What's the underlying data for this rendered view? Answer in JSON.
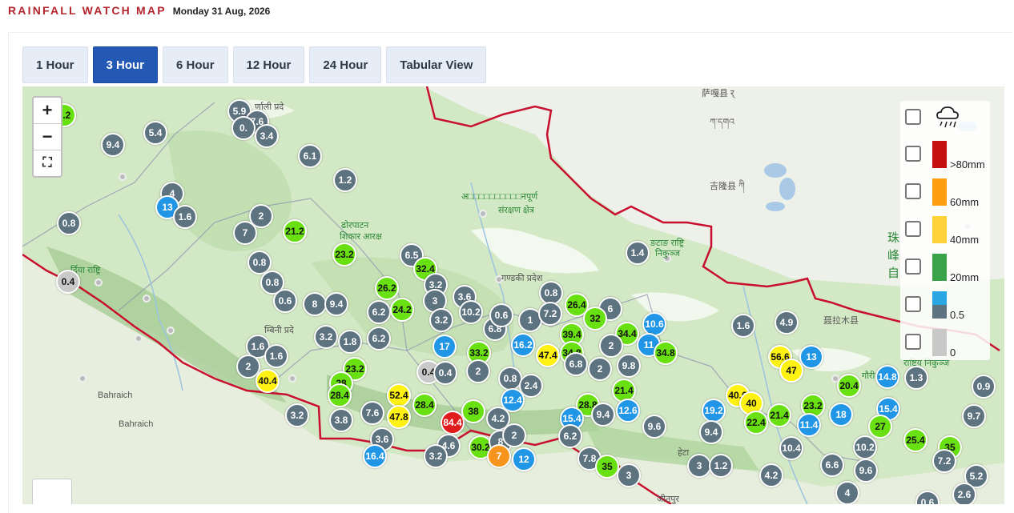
{
  "header": {
    "title": "RAINFALL WATCH MAP",
    "date": "Monday 31 Aug, 2026"
  },
  "tabs": [
    {
      "label": "1 Hour",
      "active": false
    },
    {
      "label": "3 Hour",
      "active": true
    },
    {
      "label": "6 Hour",
      "active": false
    },
    {
      "label": "12 Hour",
      "active": false
    },
    {
      "label": "24 Hour",
      "active": false
    },
    {
      "label": "Tabular View",
      "active": false
    }
  ],
  "legend": {
    "icon": "rain-cloud-icon",
    "items": [
      {
        "label": ">80mm",
        "color": "#c4100f"
      },
      {
        "label": "60mm",
        "color": "#ff9e10"
      },
      {
        "label": "40mm",
        "color": "#ffd23a"
      },
      {
        "label": "20mm",
        "color": "#3aa34a"
      },
      {
        "label": "0.5",
        "color": "#2aa7e3"
      },
      {
        "label": "0",
        "color": "#c8c8c8"
      }
    ]
  },
  "colors": {
    "gray": "#5e7380",
    "blue": "#2196e6",
    "green": "#69e012",
    "yellow": "#fff111",
    "orange": "#f7941d",
    "red": "#e01b1b",
    "zero": "#c9c9c9",
    "border": "#c8102e"
  },
  "map_labels": {
    "karnali": "र्णाली प्रदे",
    "bardiya": "र्दिया राष्ट्रि",
    "dhorpatan": "ढोरपाटन",
    "dhorpatan2": "शिकार आरक्ष",
    "annapurna": "अ□□□□□□□□□□नपूर्ण",
    "annapurna2": "संरक्षण क्षेत्र",
    "gandaki": "गण्डकी प्रदेश",
    "lumbini": "म्बिनी प्रदे",
    "bahraich1": "Bahraich",
    "bahraich2": "Bahraich",
    "tibet1": "萨嘎县 र्",
    "tibet2": "ཀ་དགའ",
    "jilong": "吉隆县 ཀི",
    "langtang": "ङटाङ राष्ट्रि",
    "langtang2": "निकुञ्ज",
    "nyalam": "聂拉木县",
    "gaurishankar": "गौरीशं",
    "gaurishankar2": "राष्ट्रिय निकुञ्ज",
    "zhu": "珠",
    "feng": "峰",
    "zi": "自",
    "heta": "हेटा",
    "jitpur": "जीतपुर"
  },
  "stations": [
    {
      "v": "1.2",
      "c": "green"
    },
    {
      "v": "5.9",
      "c": "gray"
    },
    {
      "v": "7.6",
      "c": "gray"
    },
    {
      "v": "0.",
      "c": "gray"
    },
    {
      "v": "3.4",
      "c": "gray"
    },
    {
      "v": "5.4",
      "c": "gray"
    },
    {
      "v": "9.4",
      "c": "gray"
    },
    {
      "v": "6.1",
      "c": "gray"
    },
    {
      "v": "1.2",
      "c": "gray"
    },
    {
      "v": "4",
      "c": "gray"
    },
    {
      "v": "13",
      "c": "blue"
    },
    {
      "v": "1.6",
      "c": "gray"
    },
    {
      "v": "0.8",
      "c": "gray"
    },
    {
      "v": "2",
      "c": "gray"
    },
    {
      "v": "7",
      "c": "gray"
    },
    {
      "v": "21.2",
      "c": "green"
    },
    {
      "v": "23.2",
      "c": "green"
    },
    {
      "v": "0.8",
      "c": "gray"
    },
    {
      "v": "0.8",
      "c": "gray"
    },
    {
      "v": "0.6",
      "c": "gray"
    },
    {
      "v": "0.4",
      "c": "zero"
    },
    {
      "v": "6.5",
      "c": "gray"
    },
    {
      "v": "32.4",
      "c": "green"
    },
    {
      "v": "3.2",
      "c": "gray"
    },
    {
      "v": "26.2",
      "c": "green"
    },
    {
      "v": "8",
      "c": "gray"
    },
    {
      "v": "9.4",
      "c": "gray"
    },
    {
      "v": "6.2",
      "c": "gray"
    },
    {
      "v": "24.2",
      "c": "green"
    },
    {
      "v": "3",
      "c": "gray"
    },
    {
      "v": "3.6",
      "c": "gray"
    },
    {
      "v": "10.2",
      "c": "gray"
    },
    {
      "v": "3.2",
      "c": "gray"
    },
    {
      "v": "6.8",
      "c": "gray"
    },
    {
      "v": "0.6",
      "c": "gray"
    },
    {
      "v": "1",
      "c": "gray"
    },
    {
      "v": "1.4",
      "c": "gray"
    },
    {
      "v": "0.8",
      "c": "gray"
    },
    {
      "v": "7.2",
      "c": "gray"
    },
    {
      "v": "26.4",
      "c": "green"
    },
    {
      "v": "6",
      "c": "gray"
    },
    {
      "v": "32",
      "c": "green"
    },
    {
      "v": "39.4",
      "c": "green"
    },
    {
      "v": "34.4",
      "c": "green"
    },
    {
      "v": "10.6",
      "c": "blue"
    },
    {
      "v": "3.2",
      "c": "gray"
    },
    {
      "v": "1.8",
      "c": "gray"
    },
    {
      "v": "1.6",
      "c": "gray"
    },
    {
      "v": "1.6",
      "c": "gray"
    },
    {
      "v": "6.2",
      "c": "gray"
    },
    {
      "v": "17",
      "c": "blue"
    },
    {
      "v": "33.2",
      "c": "green"
    },
    {
      "v": "16.2",
      "c": "blue"
    },
    {
      "v": "47.4",
      "c": "yellow"
    },
    {
      "v": "34.8",
      "c": "green"
    },
    {
      "v": "2",
      "c": "gray"
    },
    {
      "v": "11",
      "c": "blue"
    },
    {
      "v": "34.8",
      "c": "green"
    },
    {
      "v": "2",
      "c": "gray"
    },
    {
      "v": "40.4",
      "c": "yellow"
    },
    {
      "v": "23.2",
      "c": "green"
    },
    {
      "v": "0.4",
      "c": "zero"
    },
    {
      "v": "0.4",
      "c": "gray"
    },
    {
      "v": "2",
      "c": "gray"
    },
    {
      "v": "0.8",
      "c": "gray"
    },
    {
      "v": "6.8",
      "c": "gray"
    },
    {
      "v": "2",
      "c": "gray"
    },
    {
      "v": "9.8",
      "c": "gray"
    },
    {
      "v": "28",
      "c": "green"
    },
    {
      "v": "28.4",
      "c": "green"
    },
    {
      "v": "52.4",
      "c": "yellow"
    },
    {
      "v": "28.4",
      "c": "green"
    },
    {
      "v": "2.4",
      "c": "gray"
    },
    {
      "v": "21.4",
      "c": "green"
    },
    {
      "v": "12.4",
      "c": "blue"
    },
    {
      "v": "3.2",
      "c": "gray"
    },
    {
      "v": "3.8",
      "c": "gray"
    },
    {
      "v": "7.6",
      "c": "gray"
    },
    {
      "v": "47.8",
      "c": "yellow"
    },
    {
      "v": "84.4",
      "c": "red"
    },
    {
      "v": "38",
      "c": "green"
    },
    {
      "v": "4.2",
      "c": "gray"
    },
    {
      "v": "28.8",
      "c": "green"
    },
    {
      "v": "15.4",
      "c": "blue"
    },
    {
      "v": "9.4",
      "c": "gray"
    },
    {
      "v": "12.6",
      "c": "blue"
    },
    {
      "v": "9.6",
      "c": "gray"
    },
    {
      "v": "3.6",
      "c": "gray"
    },
    {
      "v": "4.6",
      "c": "gray"
    },
    {
      "v": "30.2",
      "c": "green"
    },
    {
      "v": "8",
      "c": "gray"
    },
    {
      "v": "2",
      "c": "gray"
    },
    {
      "v": "6.2",
      "c": "gray"
    },
    {
      "v": "16.4",
      "c": "blue"
    },
    {
      "v": "3.2",
      "c": "gray"
    },
    {
      "v": "7",
      "c": "orange"
    },
    {
      "v": "12",
      "c": "blue"
    },
    {
      "v": "7.8",
      "c": "gray"
    },
    {
      "v": "35",
      "c": "green"
    },
    {
      "v": "3",
      "c": "gray"
    },
    {
      "v": "1.6",
      "c": "gray"
    },
    {
      "v": "4.9",
      "c": "gray"
    },
    {
      "v": "56.6",
      "c": "yellow"
    },
    {
      "v": "13",
      "c": "blue"
    },
    {
      "v": "47",
      "c": "yellow"
    },
    {
      "v": "20.4",
      "c": "green"
    },
    {
      "v": "14.8",
      "c": "blue"
    },
    {
      "v": "1.3",
      "c": "gray"
    },
    {
      "v": "0.9",
      "c": "gray"
    },
    {
      "v": "40.6",
      "c": "yellow"
    },
    {
      "v": "40",
      "c": "yellow"
    },
    {
      "v": "23.2",
      "c": "green"
    },
    {
      "v": "18",
      "c": "blue"
    },
    {
      "v": "15.4",
      "c": "blue"
    },
    {
      "v": "19.2",
      "c": "blue"
    },
    {
      "v": "22.4",
      "c": "green"
    },
    {
      "v": "21.4",
      "c": "green"
    },
    {
      "v": "11.4",
      "c": "blue"
    },
    {
      "v": "27",
      "c": "green"
    },
    {
      "v": "9.7",
      "c": "gray"
    },
    {
      "v": "9.4",
      "c": "gray"
    },
    {
      "v": "10.4",
      "c": "gray"
    },
    {
      "v": "10.2",
      "c": "gray"
    },
    {
      "v": "25.4",
      "c": "green"
    },
    {
      "v": "35",
      "c": "green"
    },
    {
      "v": "3",
      "c": "gray"
    },
    {
      "v": "1.2",
      "c": "gray"
    },
    {
      "v": "4.2",
      "c": "gray"
    },
    {
      "v": "6.6",
      "c": "gray"
    },
    {
      "v": "9.6",
      "c": "gray"
    },
    {
      "v": "7.2",
      "c": "gray"
    },
    {
      "v": "4",
      "c": "gray"
    },
    {
      "v": "5.2",
      "c": "gray"
    },
    {
      "v": "2.6",
      "c": "gray"
    },
    {
      "v": "0.6",
      "c": "gray"
    }
  ]
}
